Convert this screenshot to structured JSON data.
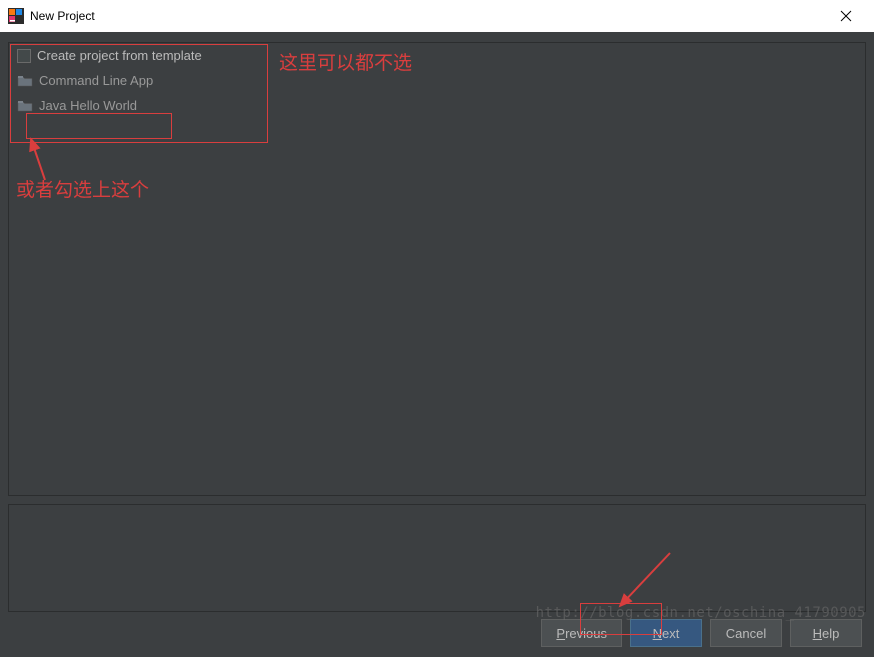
{
  "window": {
    "title": "New Project"
  },
  "content": {
    "checkbox_label_pre": "Create project from ",
    "checkbox_label_mnemonic": "t",
    "checkbox_label_post": "emplate",
    "templates": [
      {
        "label": "Command Line App"
      },
      {
        "label": "Java Hello World"
      }
    ]
  },
  "buttons": {
    "previous_pre": "",
    "previous_mn": "P",
    "previous_post": "revious",
    "next_pre": "",
    "next_mn": "N",
    "next_post": "ext",
    "cancel": "Cancel",
    "help_pre": "",
    "help_mn": "H",
    "help_post": "elp"
  },
  "annotations": {
    "text1": "这里可以都不选",
    "text2": "或者勾选上这个"
  },
  "watermark": "http://blog.csdn.net/oschina_41790905"
}
